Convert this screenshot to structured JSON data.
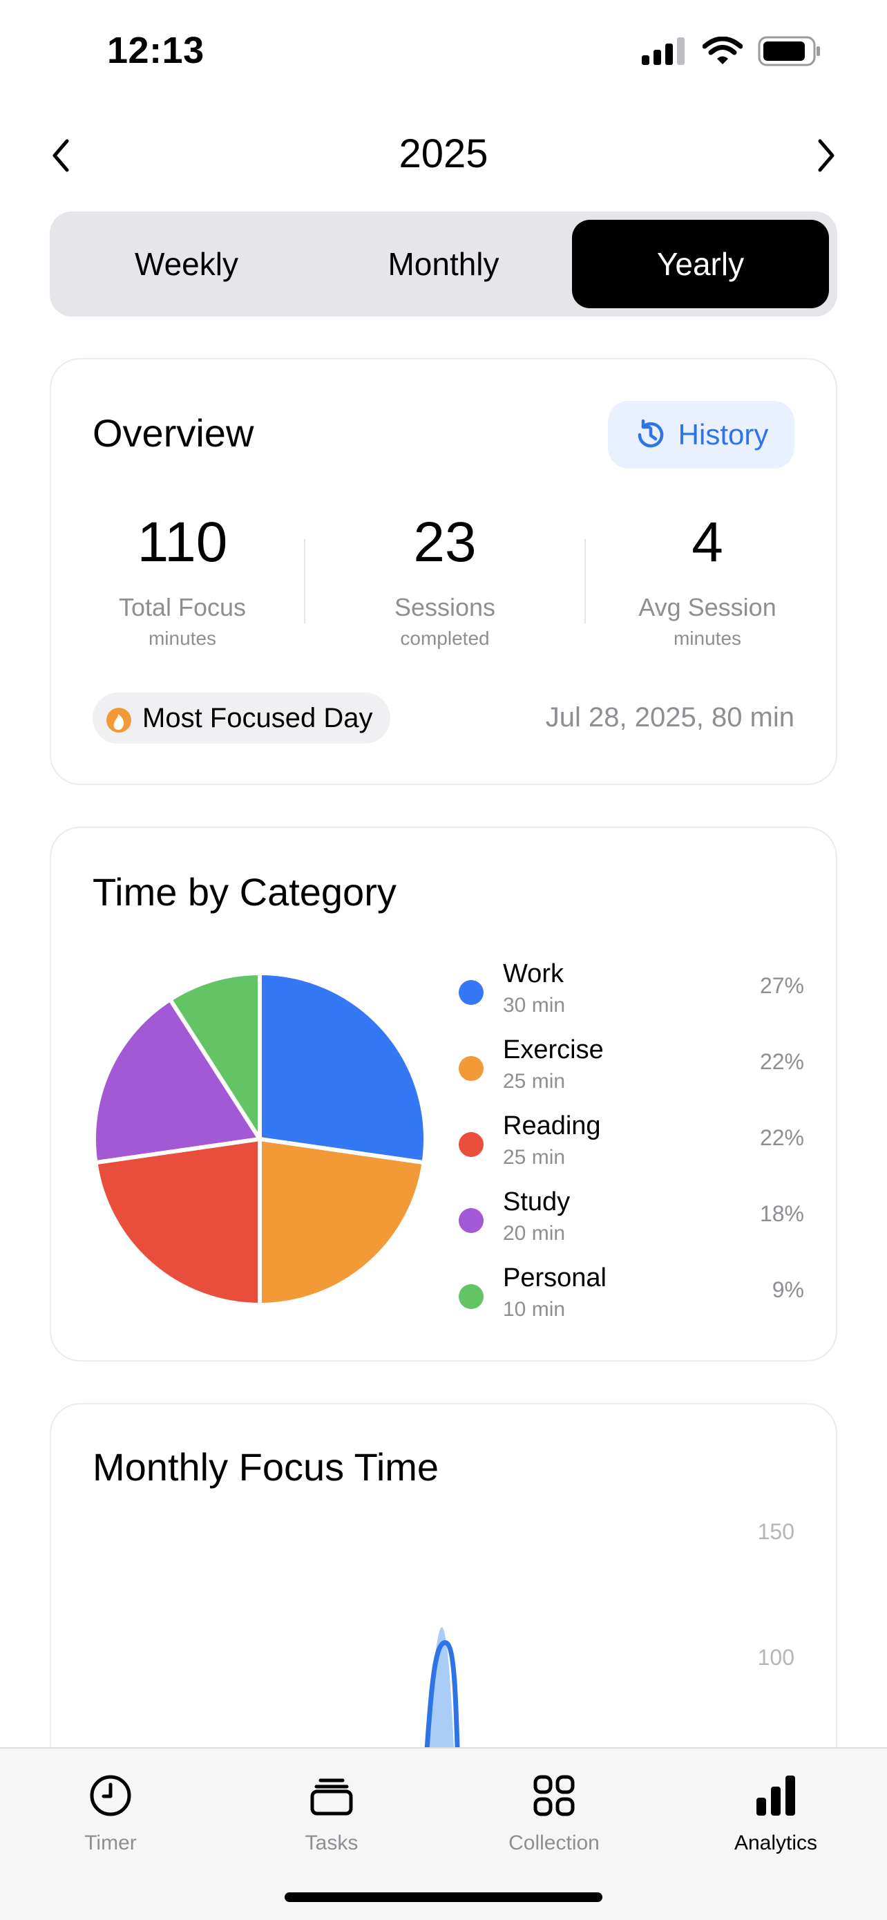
{
  "status_bar": {
    "time": "12:13"
  },
  "header": {
    "year": "2025"
  },
  "tabs_period": {
    "weekly": "Weekly",
    "monthly": "Monthly",
    "yearly": "Yearly",
    "selected": "Yearly"
  },
  "overview": {
    "title": "Overview",
    "history_label": "History",
    "stats": [
      {
        "value": "110",
        "label": "Total Focus",
        "sub": "minutes"
      },
      {
        "value": "23",
        "label": "Sessions",
        "sub": "completed"
      },
      {
        "value": "4",
        "label": "Avg Session",
        "sub": "minutes"
      }
    ],
    "most_focused_label": "Most Focused Day",
    "most_focused_value": "Jul 28, 2025, 80 min"
  },
  "category": {
    "title": "Time by Category",
    "items": [
      {
        "name": "Work",
        "minutes": "30 min",
        "pct": "27%",
        "value": 30,
        "color": "#3478f6"
      },
      {
        "name": "Exercise",
        "minutes": "25 min",
        "pct": "22%",
        "value": 25,
        "color": "#f19a37"
      },
      {
        "name": "Reading",
        "minutes": "25 min",
        "pct": "22%",
        "value": 25,
        "color": "#e94e3d"
      },
      {
        "name": "Study",
        "minutes": "20 min",
        "pct": "18%",
        "value": 20,
        "color": "#a358d5"
      },
      {
        "name": "Personal",
        "minutes": "10 min",
        "pct": "9%",
        "value": 10,
        "color": "#63c466"
      }
    ]
  },
  "monthly": {
    "title": "Monthly Focus Time",
    "y_ticks": [
      "150",
      "100"
    ]
  },
  "chart_data": {
    "type": "pie",
    "title": "Time by Category",
    "categories": [
      "Work",
      "Exercise",
      "Reading",
      "Study",
      "Personal"
    ],
    "values": [
      30,
      25,
      25,
      20,
      10
    ],
    "unit": "min"
  },
  "tab_bar": {
    "items": [
      {
        "label": "Timer",
        "icon": "clock-icon"
      },
      {
        "label": "Tasks",
        "icon": "tray-stack-icon"
      },
      {
        "label": "Collection",
        "icon": "grid-icon"
      },
      {
        "label": "Analytics",
        "icon": "bar-chart-icon"
      }
    ],
    "active": "Analytics"
  },
  "colors": {
    "accent": "#2f74e6",
    "selected_segment": "#000000"
  }
}
